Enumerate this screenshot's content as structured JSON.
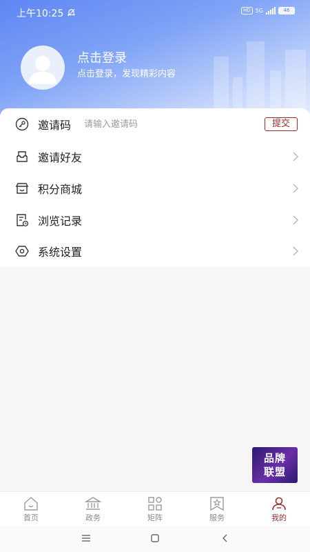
{
  "status": {
    "time": "上午10:25",
    "hd": "HD",
    "net": "5G",
    "battery": "46"
  },
  "profile": {
    "title": "点击登录",
    "subtitle": "点击登录，发现精彩内容"
  },
  "invite": {
    "label": "邀请码",
    "placeholder": "请输入邀请码",
    "submit": "提交"
  },
  "menu": {
    "items": [
      {
        "label": "邀请好友",
        "icon": "invite-friends-icon"
      },
      {
        "label": "积分商城",
        "icon": "store-icon"
      },
      {
        "label": "浏览记录",
        "icon": "history-icon"
      },
      {
        "label": "系统设置",
        "icon": "settings-icon"
      }
    ]
  },
  "brand_badge": {
    "line1": "品牌",
    "line2": "联盟"
  },
  "tabs": [
    {
      "label": "首页",
      "icon": "home-icon"
    },
    {
      "label": "政务",
      "icon": "government-icon"
    },
    {
      "label": "矩阵",
      "icon": "matrix-icon"
    },
    {
      "label": "服务",
      "icon": "service-icon"
    },
    {
      "label": "我的",
      "icon": "user-icon",
      "active": true
    }
  ],
  "colors": {
    "accent": "#9b2a2a",
    "header": "#6b8ff4"
  }
}
